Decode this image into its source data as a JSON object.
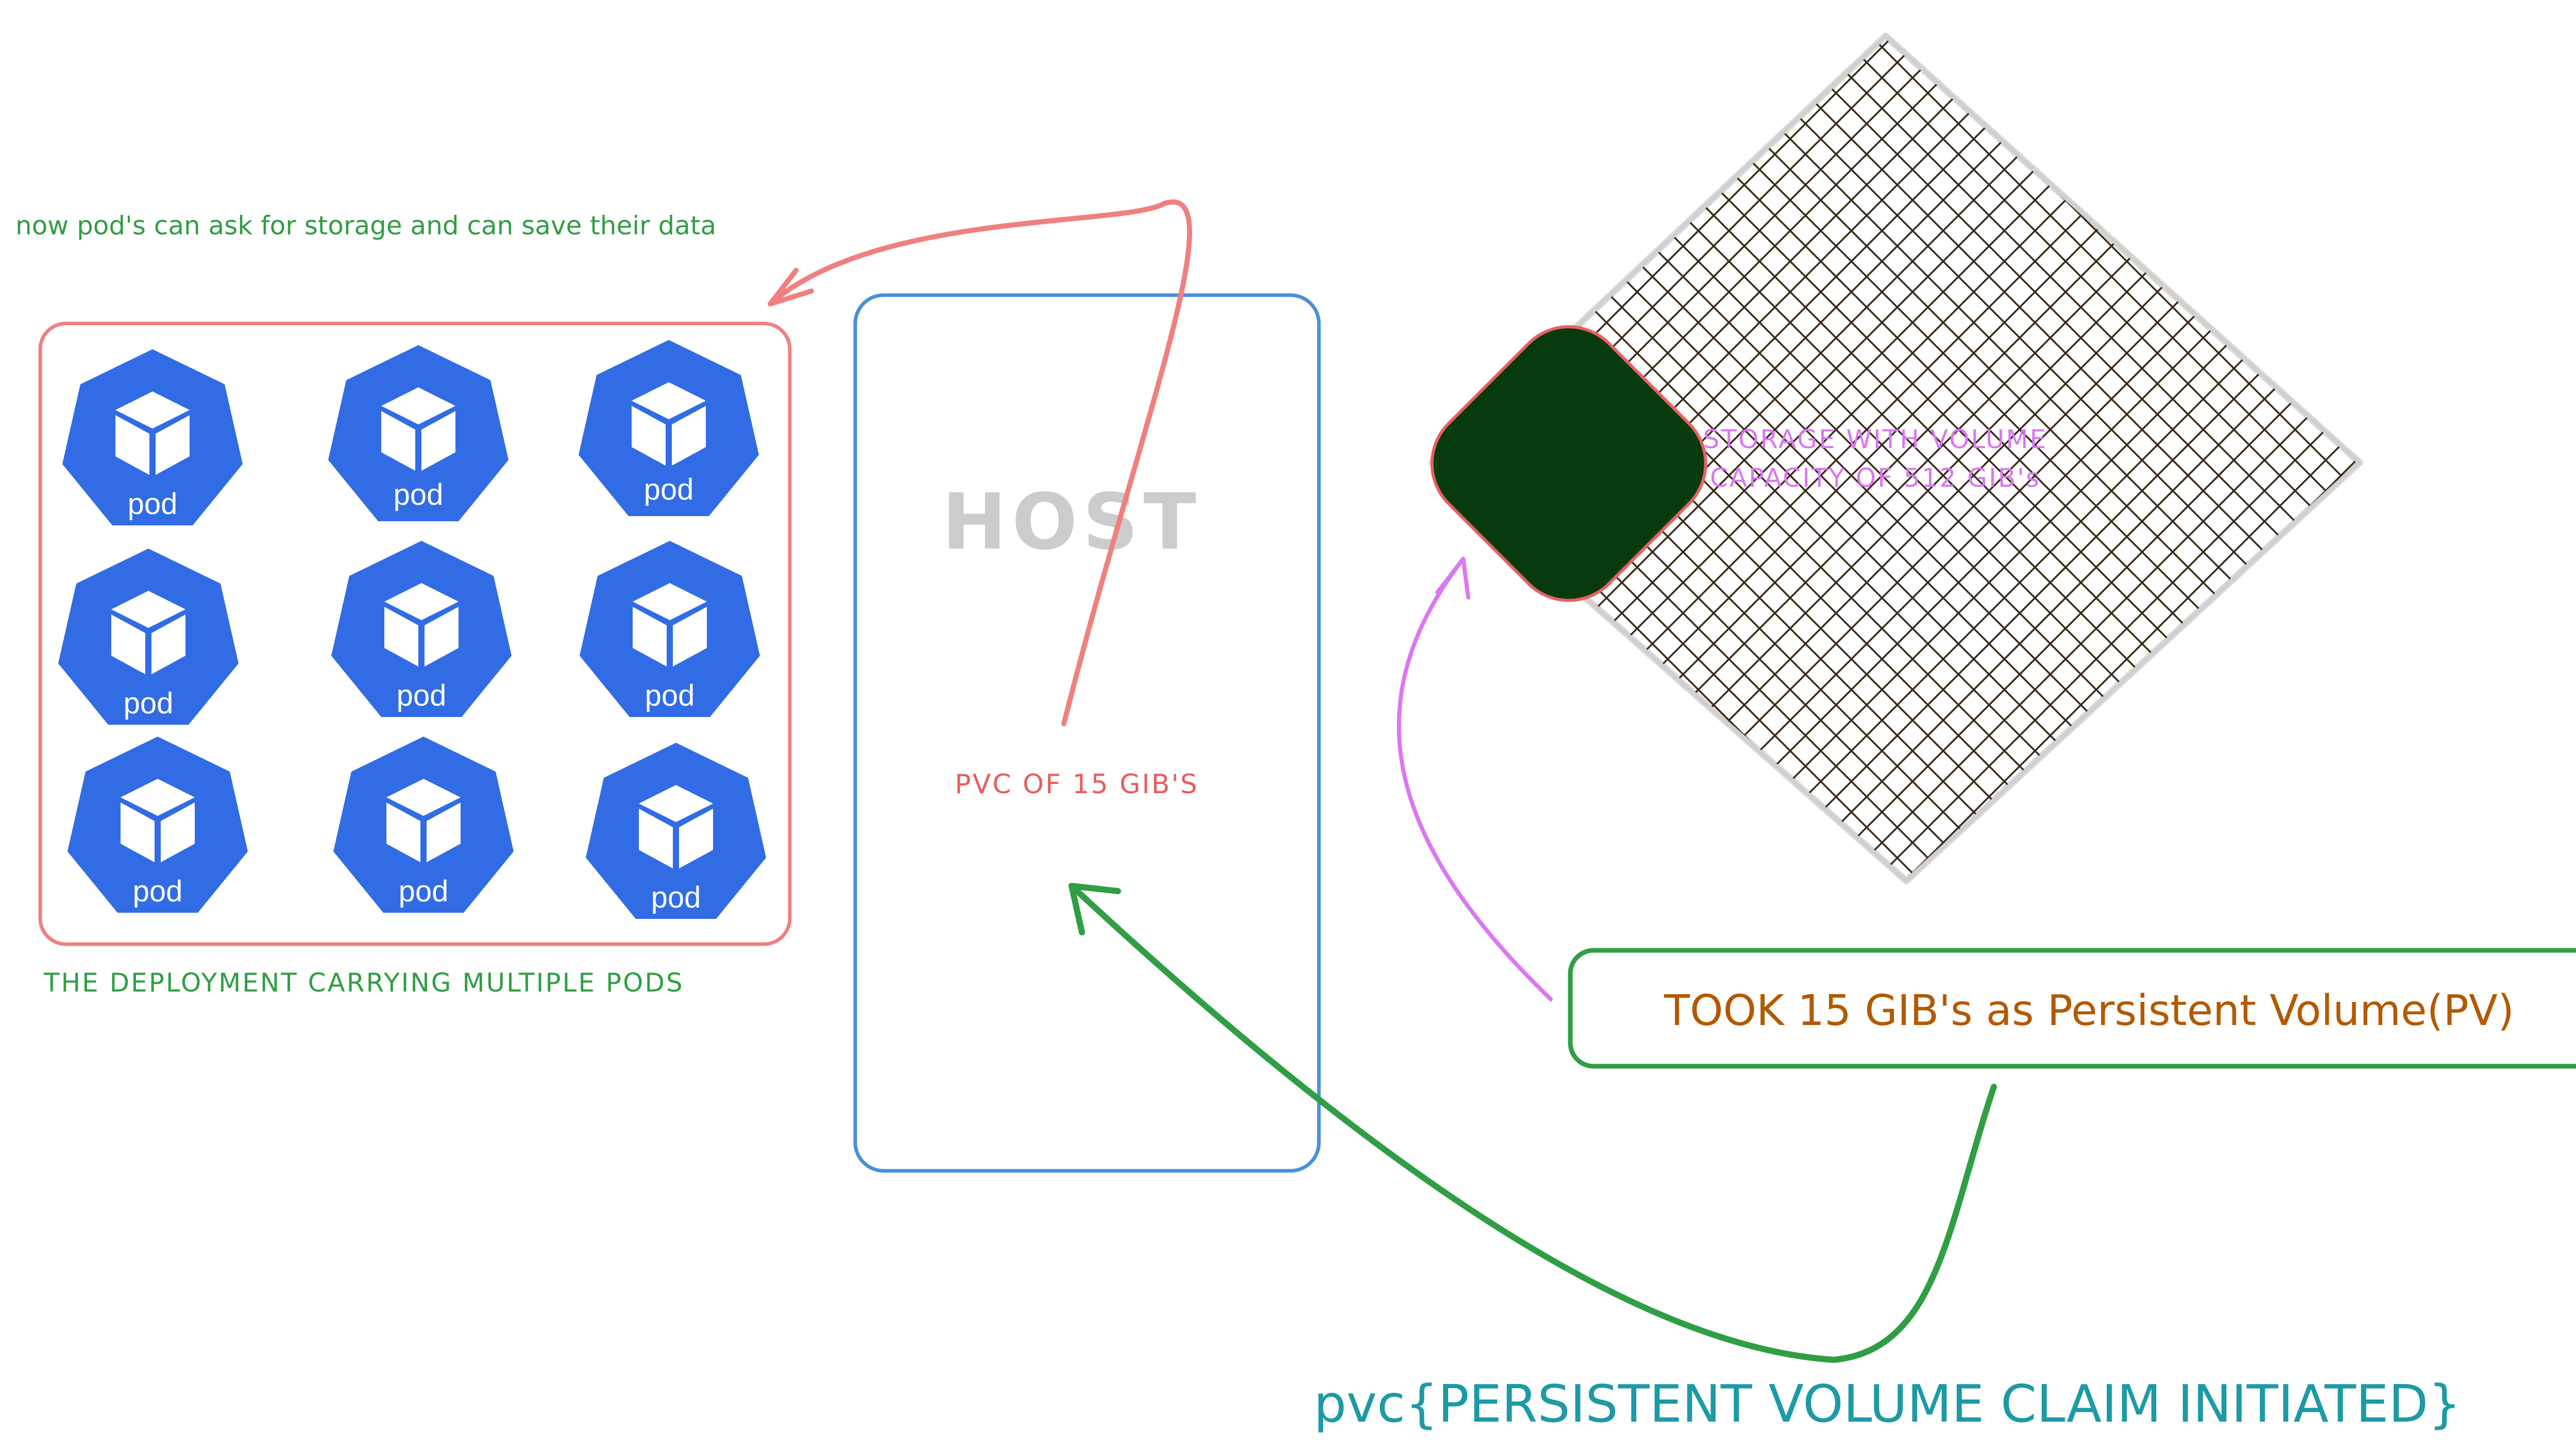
{
  "texts": {
    "top_note": "now pod's can ask for storage and can save their data",
    "deployment_caption": "THE DEPLOYMENT CARRYING MULTIPLE PODS",
    "host_label": "HOST",
    "pvc_label": "PVC OF 15 GIB'S",
    "storage_label_line1": "STORAGE WITH VOLUME",
    "storage_label_line2": "CAPACITY OF 512 GIB's",
    "pv_box_label": "TOOK 15 GIB's as Persistent Volume(PV)",
    "bottom_note": "pvc{PERSISTENT VOLUME CLAIM INITIATED}"
  },
  "pods": [
    "pod",
    "pod",
    "pod",
    "pod",
    "pod",
    "pod",
    "pod",
    "pod",
    "pod"
  ],
  "colors": {
    "pod_blue": "#326ce5",
    "deployment_border": "#f08080",
    "host_border": "#4a90d9",
    "host_text": "#cccccc",
    "green_text": "#2f9e44",
    "green_border": "#2f9e44",
    "pvc_text": "#e85d5d",
    "storage_text": "#da77f2",
    "storage_pattern": "#3b2a1a",
    "pv_chunk": "#073b0e",
    "pv_box_text": "#b35900",
    "bottom_text": "#1c9aa6",
    "arrow_red": "#f08080",
    "arrow_pink": "#da77f2",
    "arrow_green": "#2f9e44"
  },
  "icons": [
    "cube-icon",
    "heptagon-pod-icon",
    "arrow-icon"
  ]
}
